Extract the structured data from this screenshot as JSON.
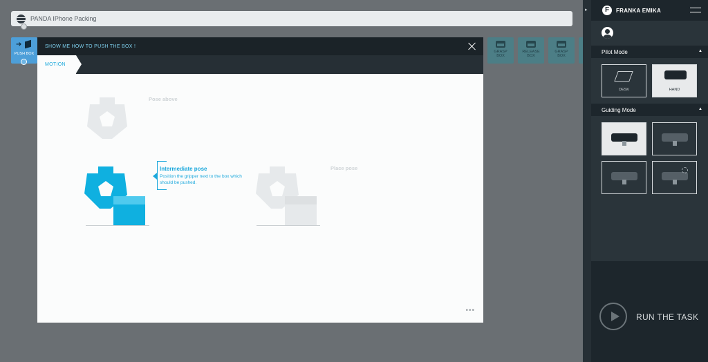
{
  "colors": {
    "accent": "#1ba8dc",
    "header_dark": "#1b2328",
    "background": "#6a6f73",
    "tile_blue": "#4d9fd9",
    "tile_teal": "#4c7e86"
  },
  "task": {
    "name": "PANDA IPhone Packing",
    "icon": "globe-icon"
  },
  "app_tile": {
    "label": "PUSH BOX"
  },
  "queue_tiles": [
    {
      "label_1": "GRASP",
      "label_2": "BOX"
    },
    {
      "label_1": "RELEASE",
      "label_2": "BOX"
    },
    {
      "label_1": "GRASP",
      "label_2": "BOX"
    }
  ],
  "dialog": {
    "title": "SHOW ME HOW TO PUSH THE BOX !",
    "tab": "MOTION",
    "poses": {
      "above": "Pose above",
      "intermediate_title": "Intermediate pose",
      "intermediate_desc": "Position the gripper next to the box which should be pushed.",
      "place": "Place pose"
    },
    "more": "•••"
  },
  "sidebar": {
    "brand": "FRANKA EMIKA",
    "pilot_mode": {
      "title": "Pilot Mode",
      "options": [
        {
          "label": "DESK",
          "selected": false
        },
        {
          "label": "HAND",
          "selected": true
        }
      ]
    },
    "guiding_mode": {
      "title": "Guiding Mode",
      "selected_index": 0
    },
    "run_label": "RUN THE TASK"
  }
}
